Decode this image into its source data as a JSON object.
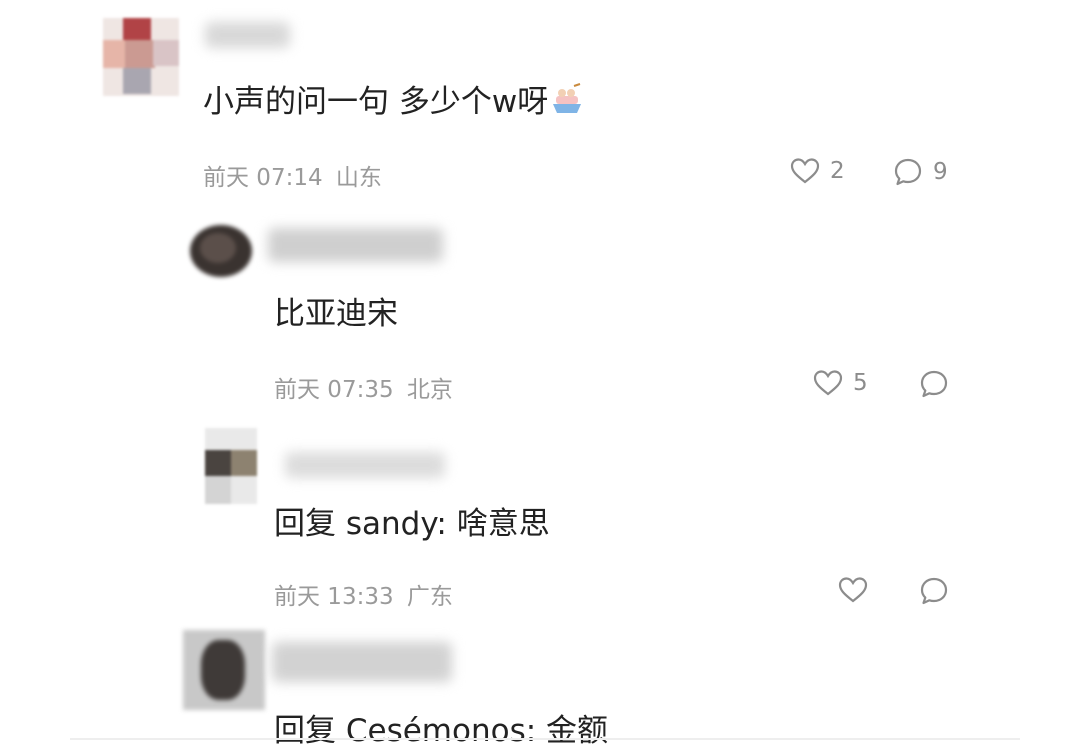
{
  "comments": [
    {
      "content": "小声的问一句 多少个w呀",
      "emoji": "rowboat-emoji",
      "time": "前天 07:14",
      "location": "山东",
      "likes": "2",
      "replies": "9"
    },
    {
      "content": "比亚迪宋",
      "time": "前天 07:35",
      "location": "北京",
      "likes": "5",
      "replies": ""
    },
    {
      "content": "回复 sandy: 啥意思",
      "time": "前天 13:33",
      "location": "广东",
      "likes": "",
      "replies": ""
    },
    {
      "content": "回复 Cesémonos: 金额"
    }
  ],
  "icons": {
    "like": "heart-outline-icon",
    "reply": "speech-bubble-icon"
  },
  "colors": {
    "text": "#222222",
    "meta": "#9a9a9a",
    "icon": "#8c8c8c"
  }
}
